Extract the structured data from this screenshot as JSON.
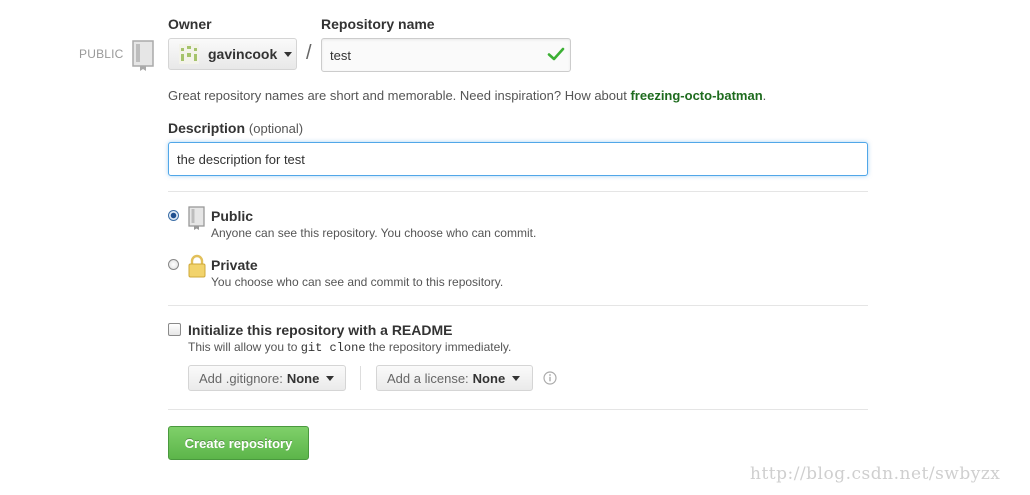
{
  "owner": {
    "label": "Owner",
    "name": "gavincook"
  },
  "repo": {
    "label": "Repository name",
    "value": "test",
    "visibility_tag": "PUBLIC"
  },
  "separator": "/",
  "hint": {
    "text": "Great repository names are short and memorable. Need inspiration? How about ",
    "suggestion": "freezing-octo-batman",
    "suffix": "."
  },
  "description": {
    "label": "Description",
    "optional": "(optional)",
    "value": "the description for test"
  },
  "visibility": {
    "public": {
      "title": "Public",
      "desc": "Anyone can see this repository. You choose who can commit.",
      "selected": true
    },
    "private": {
      "title": "Private",
      "desc": "You choose who can see and commit to this repository.",
      "selected": false
    }
  },
  "init": {
    "title": "Initialize this repository with a README",
    "desc_before": "This will allow you to ",
    "desc_code": "git clone",
    "desc_after": " the repository immediately.",
    "checked": false
  },
  "gitignore": {
    "label": "Add .gitignore:",
    "value": "None"
  },
  "license": {
    "label": "Add a license:",
    "value": "None"
  },
  "submit": {
    "label": "Create repository"
  },
  "watermark": "http://blog.csdn.net/swbyzx",
  "colors": {
    "accent_green": "#5cb54a",
    "suggestion_green": "#1e6b1e",
    "focus_blue": "#51a7e8"
  },
  "icons": [
    "repo-icon",
    "owner-avatar-icon",
    "caret-down-icon",
    "check-icon",
    "lock-icon",
    "info-icon"
  ]
}
